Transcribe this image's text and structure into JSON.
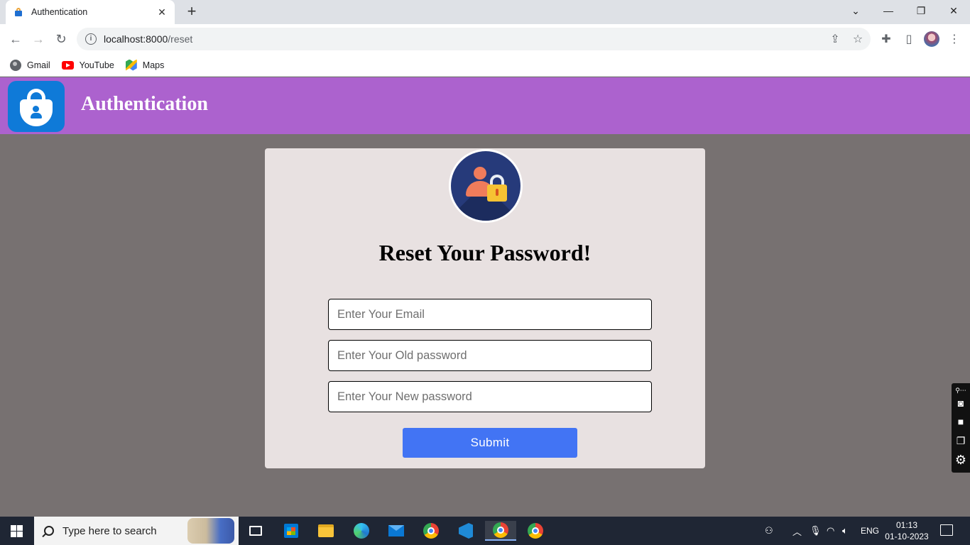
{
  "browser": {
    "tab_title": "Authentication",
    "tab_close": "✕",
    "new_tab": "+",
    "url_host": "localhost:8000",
    "url_path": "/reset",
    "bookmarks": [
      {
        "label": "Gmail",
        "icon": "globe-icon"
      },
      {
        "label": "YouTube",
        "icon": "youtube-icon"
      },
      {
        "label": "Maps",
        "icon": "maps-icon"
      }
    ]
  },
  "header": {
    "brand": "Authentication",
    "logo_icon": "authenticator-lock-icon",
    "accent_color": "#ac62ce"
  },
  "form": {
    "title": "Reset Your Password!",
    "avatar_icon": "user-lock-icon",
    "email_placeholder": "Enter Your Email",
    "old_password_placeholder": "Enter Your Old password",
    "new_password_placeholder": "Enter Your New password",
    "submit_label": "Submit",
    "submit_color": "#4274f4"
  },
  "taskbar": {
    "search_placeholder": "Type here to search",
    "language": "ENG",
    "time": "01:13",
    "date": "01-10-2023"
  }
}
